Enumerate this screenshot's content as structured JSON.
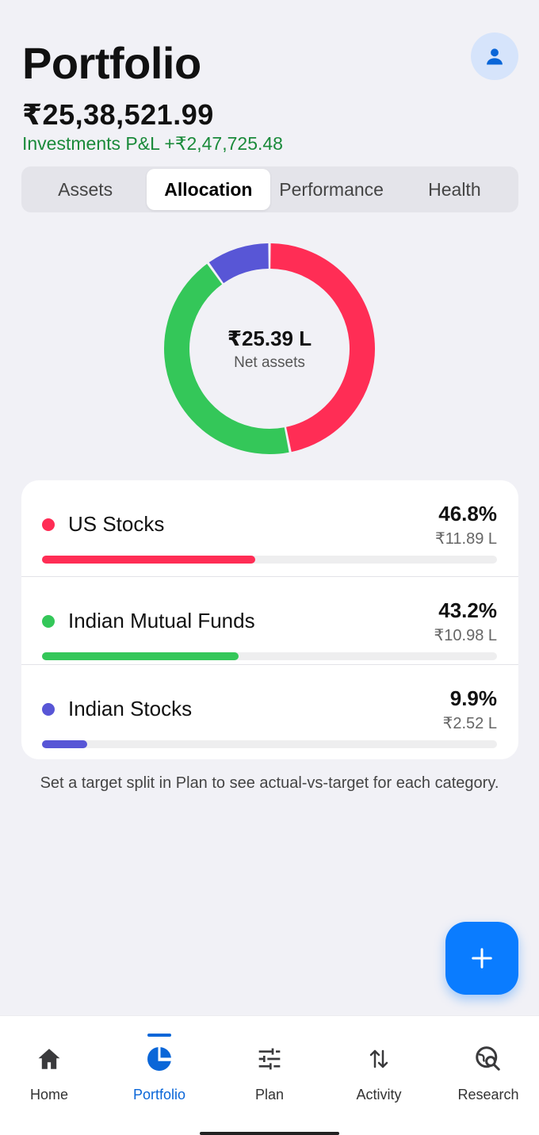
{
  "header": {
    "title": "Portfolio",
    "total_value": "₹25,38,521.99",
    "pnl": "Investments P&L +₹2,47,725.48",
    "profile_icon": "person-icon"
  },
  "tabs": [
    {
      "label": "Assets",
      "active": false
    },
    {
      "label": "Allocation",
      "active": true
    },
    {
      "label": "Performance",
      "active": false
    },
    {
      "label": "Health",
      "active": false
    }
  ],
  "donut": {
    "center_value": "₹25.39 L",
    "center_label": "Net assets"
  },
  "chart_data": {
    "type": "pie",
    "categories": [
      "US Stocks",
      "Indian Mutual Funds",
      "Indian Stocks"
    ],
    "values": [
      46.8,
      43.2,
      9.9
    ],
    "colors": [
      "#ff2d55",
      "#34c759",
      "#5856d6"
    ],
    "style": "donut"
  },
  "allocations": [
    {
      "name": "US Stocks",
      "percent": "46.8%",
      "amount": "₹11.89 L",
      "fraction": 0.468,
      "color": "#ff2d55"
    },
    {
      "name": "Indian Mutual Funds",
      "percent": "43.2%",
      "amount": "₹10.98 L",
      "fraction": 0.432,
      "color": "#34c759"
    },
    {
      "name": "Indian Stocks",
      "percent": "9.9%",
      "amount": "₹2.52 L",
      "fraction": 0.099,
      "color": "#5856d6"
    }
  ],
  "hint": "Set a target split in Plan to see actual-vs-target for each category.",
  "fab": {
    "icon": "plus-icon"
  },
  "nav": [
    {
      "label": "Home",
      "icon": "home-icon",
      "active": false
    },
    {
      "label": "Portfolio",
      "icon": "pie-chart-icon",
      "active": true
    },
    {
      "label": "Plan",
      "icon": "sliders-icon",
      "active": false
    },
    {
      "label": "Activity",
      "icon": "swap-vertical-icon",
      "active": false
    },
    {
      "label": "Research",
      "icon": "search-globe-icon",
      "active": false
    }
  ],
  "colors": {
    "accent": "#0a7cff",
    "active_nav": "#0a66d8",
    "pnl_green": "#1a8a3a"
  }
}
